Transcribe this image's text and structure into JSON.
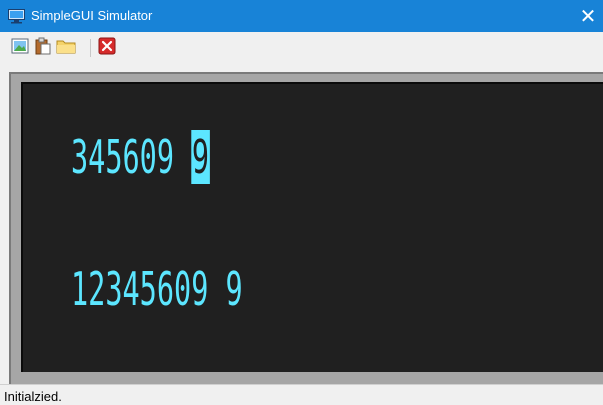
{
  "window": {
    "title": "SimpleGUI Simulator",
    "close_glyph": "✕",
    "app_icon": "monitor-icon"
  },
  "toolbar": {
    "buttons": [
      {
        "icon": "image-icon"
      },
      {
        "icon": "paste-icon"
      },
      {
        "icon": "folder-icon"
      },
      {
        "icon": "close-red-icon"
      }
    ]
  },
  "lcd": {
    "line1_text": "345609 ",
    "line1_cursor": "9",
    "line2_text": "12345609 9",
    "text_color": "#5ce6ff",
    "background": "#202020"
  },
  "status": {
    "text": "Initialzied."
  }
}
